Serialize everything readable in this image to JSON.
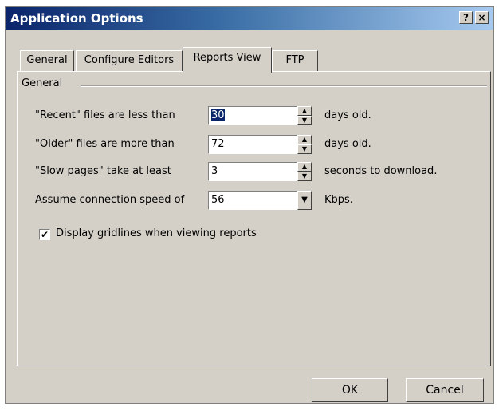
{
  "window": {
    "title": "Application Options",
    "help_label": "?",
    "close_label": "×"
  },
  "tabs": [
    {
      "label": "General"
    },
    {
      "label": "Configure Editors"
    },
    {
      "label": "Reports View"
    },
    {
      "label": "FTP"
    }
  ],
  "active_tab": "Reports View",
  "group": {
    "label": "General"
  },
  "rows": [
    {
      "label": "\"Recent\" files are less than",
      "value": "30",
      "unit": "days old."
    },
    {
      "label": "\"Older\" files are more than",
      "value": "72",
      "unit": "days old."
    },
    {
      "label": "\"Slow pages\" take at least",
      "value": "3",
      "unit": "seconds to download."
    },
    {
      "label": "Assume connection speed of",
      "value": "56",
      "unit": "Kbps."
    }
  ],
  "checkbox": {
    "label": "Display gridlines when viewing reports",
    "checked": true
  },
  "buttons": {
    "ok": "OK",
    "cancel": "Cancel"
  },
  "icons": {
    "spin_up": "▲",
    "spin_down": "▼",
    "dropdown": "▼",
    "check": "✔"
  },
  "colors": {
    "titlebar_start": "#0a246a",
    "titlebar_end": "#a6caf0",
    "face": "#d4d0c8",
    "selection": "#0a246a"
  }
}
